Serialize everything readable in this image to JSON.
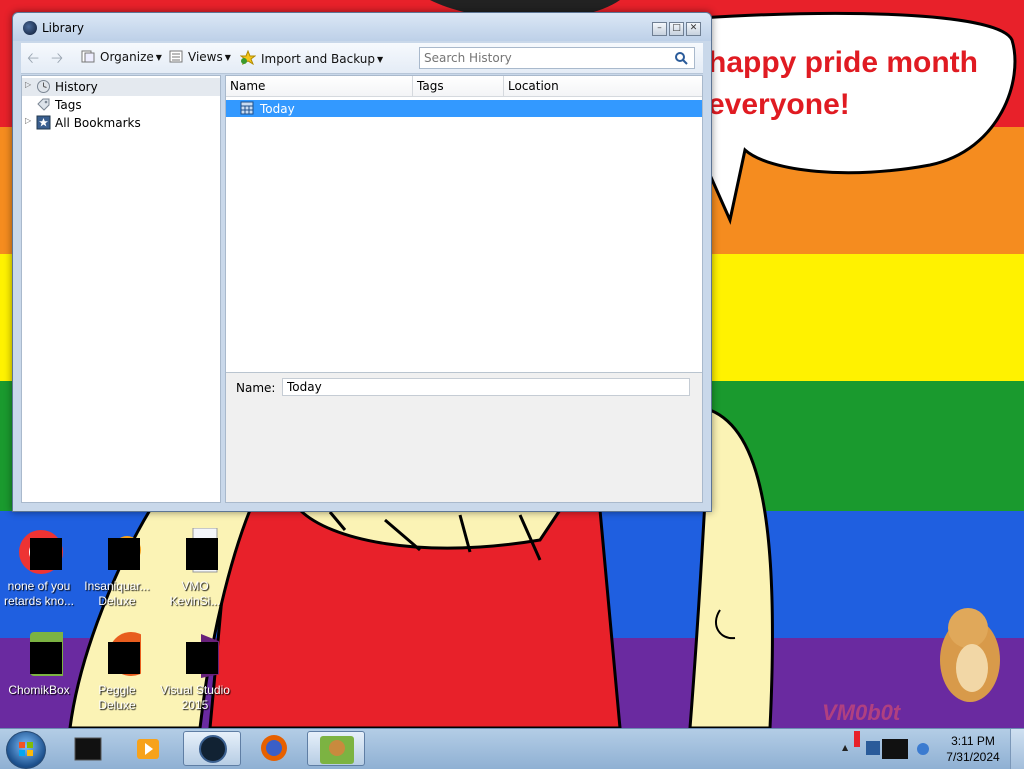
{
  "wallpaper": {
    "speech_line1": "happy pride month",
    "speech_line2": "everyone!",
    "watermark": "VM0b0t"
  },
  "desktop_icons": [
    {
      "label1": "none of you",
      "label2": "retards kno..."
    },
    {
      "label1": "Insaniquar...",
      "label2": "Deluxe"
    },
    {
      "label1": "VMO",
      "label2": "KevinSi..."
    },
    {
      "label1": "ChomikBox",
      "label2": ""
    },
    {
      "label1": "Peggle Deluxe",
      "label2": ""
    },
    {
      "label1": "Visual Studio",
      "label2": "2015"
    }
  ],
  "window": {
    "title": "Library",
    "toolbar": {
      "organize": "Organize",
      "views": "Views",
      "import_backup": "Import and Backup"
    },
    "search": {
      "placeholder": "Search History"
    },
    "sidebar": {
      "items": [
        {
          "label": "History",
          "icon": "clock-icon",
          "expandable": true,
          "selected": true
        },
        {
          "label": "Tags",
          "icon": "tag-icon",
          "expandable": false
        },
        {
          "label": "All Bookmarks",
          "icon": "star-icon",
          "expandable": true
        }
      ]
    },
    "table": {
      "columns": [
        "Name",
        "Tags",
        "Location"
      ],
      "rows": [
        {
          "name": "Today",
          "icon": "calendar-icon",
          "selected": true
        }
      ]
    },
    "details": {
      "name_label": "Name:",
      "name_value": "Today"
    }
  },
  "taskbar": {
    "clock_time": "3:11 PM",
    "clock_date": "7/31/2024"
  },
  "colors": {
    "selection": "#3399ff",
    "speech_text": "#e01b22"
  }
}
